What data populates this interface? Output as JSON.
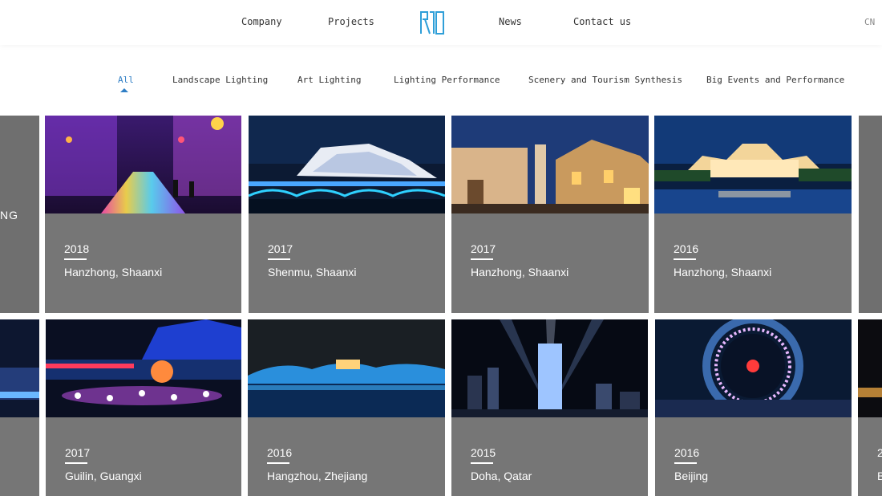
{
  "header": {
    "nav": [
      {
        "label": "Company"
      },
      {
        "label": "Projects"
      },
      {
        "label": "News"
      },
      {
        "label": "Contact us"
      }
    ],
    "logo_icon": "rso-logo-icon",
    "lang": "CN"
  },
  "filter": {
    "tabs": [
      {
        "label": "All",
        "active": true
      },
      {
        "label": "Landscape Lighting"
      },
      {
        "label": "Art Lighting"
      },
      {
        "label": "Lighting Performance"
      },
      {
        "label": "Scenery and Tourism Synthesis"
      },
      {
        "label": "Big Events and Performance"
      }
    ]
  },
  "colors": {
    "accent": "#2f7ec5",
    "card_bg": "#767676",
    "logo": "#2f9fd8"
  },
  "left_edge_text": "NG",
  "projects_row1": [
    {
      "year": "2018",
      "place": "Hanzhong, Shaanxi"
    },
    {
      "year": "2017",
      "place": "Shenmu, Shaanxi"
    },
    {
      "year": "2017",
      "place": "Hanzhong, Shaanxi"
    },
    {
      "year": "2016",
      "place": "Hanzhong, Shaanxi"
    }
  ],
  "projects_row2": [
    {
      "year": "2017",
      "place": "Guilin, Guangxi"
    },
    {
      "year": "2016",
      "place": "Hangzhou, Zhejiang"
    },
    {
      "year": "2015",
      "place": "Doha, Qatar"
    },
    {
      "year": "2016",
      "place": "Beijing"
    }
  ],
  "right_edge_row2": {
    "year": "2",
    "place": "B"
  }
}
